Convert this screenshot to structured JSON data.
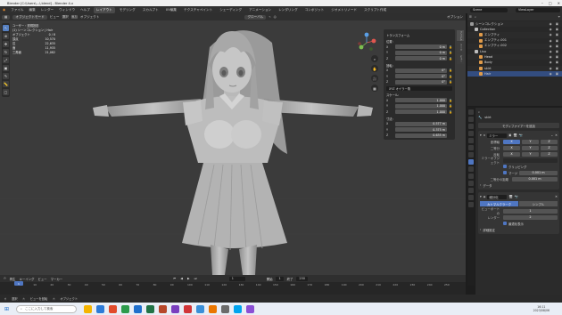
{
  "window": {
    "title": "Blender [C:\\Users\\...\\.blend] - Blender 4.x"
  },
  "menubar": {
    "items": [
      "ファイル",
      "編集",
      "レンダー",
      "ウィンドウ",
      "ヘルプ"
    ],
    "workspaces": [
      "レイアウト",
      "モデリング",
      "スカルプト",
      "UV編集",
      "テクスチャペイント",
      "シェーディング",
      "アニメーション",
      "レンダリング",
      "コンポジット",
      "ジオメトリノード",
      "スクリプト作成"
    ],
    "active_workspace": "レイアウト",
    "scene": "Scene",
    "view_layer": "ViewLayer"
  },
  "viewport_header": {
    "mode": "オブジェクトモード",
    "menus": [
      "ビュー",
      "選択",
      "追加",
      "オブジェクト"
    ],
    "transform": "グローバル",
    "options": "オプション"
  },
  "stats": {
    "view_name": "ユーザー・透視投影",
    "collection": "(1) シーンコレクション | Hair",
    "rows": [
      {
        "label": "オブジェクト",
        "value": "0 / 8"
      },
      {
        "label": "頂点",
        "value": "10,570"
      },
      {
        "label": "辺",
        "value": "22,635"
      },
      {
        "label": "面",
        "value": "11,935"
      },
      {
        "label": "三角面",
        "value": "21,082"
      }
    ]
  },
  "npanel": {
    "title": "トランスフォーム",
    "location_label": "位置:",
    "location": [
      {
        "axis": "X",
        "value": "0 m"
      },
      {
        "axis": "Y",
        "value": "0 m"
      },
      {
        "axis": "Z",
        "value": "0 m"
      }
    ],
    "rotation_label": "回転:",
    "rotation": [
      {
        "axis": "X",
        "value": "0°"
      },
      {
        "axis": "Y",
        "value": "0°"
      },
      {
        "axis": "Z",
        "value": "0°"
      }
    ],
    "rotation_mode": "XYZ オイラー角",
    "scale_label": "スケール:",
    "scale": [
      {
        "axis": "X",
        "value": "1.000"
      },
      {
        "axis": "Y",
        "value": "1.000"
      },
      {
        "axis": "Z",
        "value": "1.000"
      }
    ],
    "dimensions_label": "寸法:",
    "dimensions": [
      {
        "axis": "X",
        "value": "0.577 m"
      },
      {
        "axis": "Y",
        "value": "0.375 m"
      },
      {
        "axis": "Z",
        "value": "0.635 m"
      }
    ],
    "tabs": [
      "アイテム",
      "ツール",
      "ビュー"
    ]
  },
  "outliner": {
    "rows": [
      {
        "name": "シーンコレクション",
        "indent": 0,
        "color": "#9a9a9a",
        "selected": false
      },
      {
        "name": "Collection",
        "indent": 1,
        "color": "#bdbdbd",
        "selected": false
      },
      {
        "name": "エンプティ",
        "indent": 2,
        "color": "#e09b4a",
        "selected": false
      },
      {
        "name": "エンプティ.001",
        "indent": 2,
        "color": "#e09b4a",
        "selected": false
      },
      {
        "name": "エンプティ.002",
        "indent": 2,
        "color": "#e09b4a",
        "selected": false
      },
      {
        "name": "Lisa",
        "indent": 1,
        "color": "#bdbdbd",
        "selected": false
      },
      {
        "name": "Head",
        "indent": 2,
        "color": "#e09b4a",
        "selected": false
      },
      {
        "name": "Body",
        "indent": 2,
        "color": "#e09b4a",
        "selected": false
      },
      {
        "name": "skirt",
        "indent": 2,
        "color": "#e09b4a",
        "selected": false
      },
      {
        "name": "Hair",
        "indent": 2,
        "color": "#e09b4a",
        "selected": true
      }
    ]
  },
  "properties": {
    "object_name": "skirt",
    "modifier_tab": "モディファイアーを追加",
    "mirror": {
      "name": "ミラー",
      "axis_label": "座標軸",
      "bisect_label": "二等分",
      "flip_label": "反転",
      "axes": [
        "X",
        "Y",
        "Z"
      ],
      "mirror_object_label": "ミラーオブジェクト",
      "clipping_label": "クリッピング",
      "merge_label": "マージ",
      "merge_value": "0.001 m",
      "bisect_distance_label": "二等分の距離",
      "bisect_distance_value": "0.001 m",
      "data_label": "データ"
    },
    "subdivision": {
      "name": "細分化",
      "types": [
        "カトマルクラーク",
        "シンプル"
      ],
      "levels_viewport_label": "ビューポートの",
      "levels_viewport": "1",
      "render_label": "レンダー",
      "render_value": "2",
      "optimal_display_label": "最適化表示",
      "advanced_label": "詳細設定"
    }
  },
  "timeline": {
    "menus": [
      "再生",
      "キーイング",
      "ビュー",
      "マーカー"
    ],
    "current_frame": "1",
    "start_label": "開始",
    "start": "1",
    "end_label": "終了",
    "end": "250",
    "ticks": [
      "0",
      "10",
      "20",
      "30",
      "40",
      "50",
      "60",
      "70",
      "80",
      "90",
      "100",
      "110",
      "120",
      "130",
      "140",
      "150",
      "160",
      "170",
      "180",
      "190",
      "200",
      "210",
      "220",
      "230",
      "240",
      "250"
    ]
  },
  "statusbar": {
    "items": [
      "選択",
      "ビューを回転",
      "オブジェクト"
    ]
  },
  "taskbar": {
    "search_placeholder": "ここに入力して検索",
    "time": "16:11",
    "date": "2023/08/06",
    "app_colors": [
      "#f5b400",
      "#2d7bd8",
      "#e24b2b",
      "#2d9b4c",
      "#1f6fcc",
      "#217346",
      "#b7472a",
      "#7a3fbf",
      "#d13438",
      "#3a8fd8",
      "#ea7600",
      "#6b6b6b",
      "#00a4ef",
      "#8b4fd6"
    ]
  },
  "colors": {
    "accent": "#4f76c2",
    "viewport": "#3b3b3b",
    "panel": "#2b2b2b"
  }
}
